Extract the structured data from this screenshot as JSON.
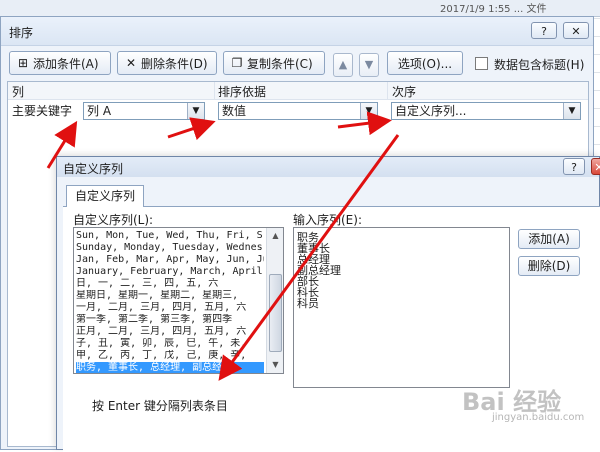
{
  "background_sheet": {
    "cell_fragment": "2017/1/9 1:55 ... 文件"
  },
  "sort_dialog": {
    "title": "排序",
    "help_button": "?",
    "close_button": "✕",
    "toolbar": {
      "add_condition": "添加条件(A)",
      "delete_condition": "删除条件(D)",
      "copy_condition": "复制条件(C)",
      "move_up": "▲",
      "move_down": "▼",
      "options": "选项(O)...",
      "header_checkbox_label": "数据包含标题(H)",
      "header_checkbox_checked": false
    },
    "columns": {
      "column": "列",
      "sort_on": "排序依据",
      "order": "次序"
    },
    "row": {
      "label": "主要关键字",
      "column_value": "列 A",
      "sort_on_value": "数值",
      "order_value": "自定义序列..."
    }
  },
  "custom_list_dialog": {
    "title": "自定义序列",
    "help_button": "?",
    "close_button": "✕",
    "tab": "自定义序列",
    "lists_label": "自定义序列(L):",
    "input_label": "输入序列(E):",
    "lists": [
      "Sun, Mon, Tue, Wed, Thu, Fri, S",
      "Sunday, Monday, Tuesday, Wednes",
      "Jan, Feb, Mar, Apr, May, Jun, Ju",
      "January, February, March, April",
      "日, 一, 二, 三, 四, 五, 六",
      "星期日, 星期一, 星期二, 星期三,",
      "一月, 二月, 三月, 四月, 五月, 六",
      "第一季, 第二季, 第三季, 第四季",
      "正月, 二月, 三月, 四月, 五月, 六",
      "子, 丑, 寅, 卯, 辰, 巳, 午, 未,",
      "甲, 乙, 丙, 丁, 戊, 己, 庚, 辛,",
      "职务, 董事长, 总经理, 副总经理,"
    ],
    "selected_list_index": 11,
    "input_entries": [
      "职务",
      "董事长",
      "总经理",
      "副总经理",
      "部长",
      "科长",
      "科员"
    ],
    "add_button": "添加(A)",
    "delete_button": "删除(D)",
    "hint": "按 Enter 键分隔列表条目"
  },
  "watermark": {
    "text": "Bai 经验",
    "sub": "jingyan.baidu.com"
  },
  "colors": {
    "annotation_arrow": "#e01010",
    "selection": "#3399ff",
    "dialog_bg": "#eef3fa"
  }
}
